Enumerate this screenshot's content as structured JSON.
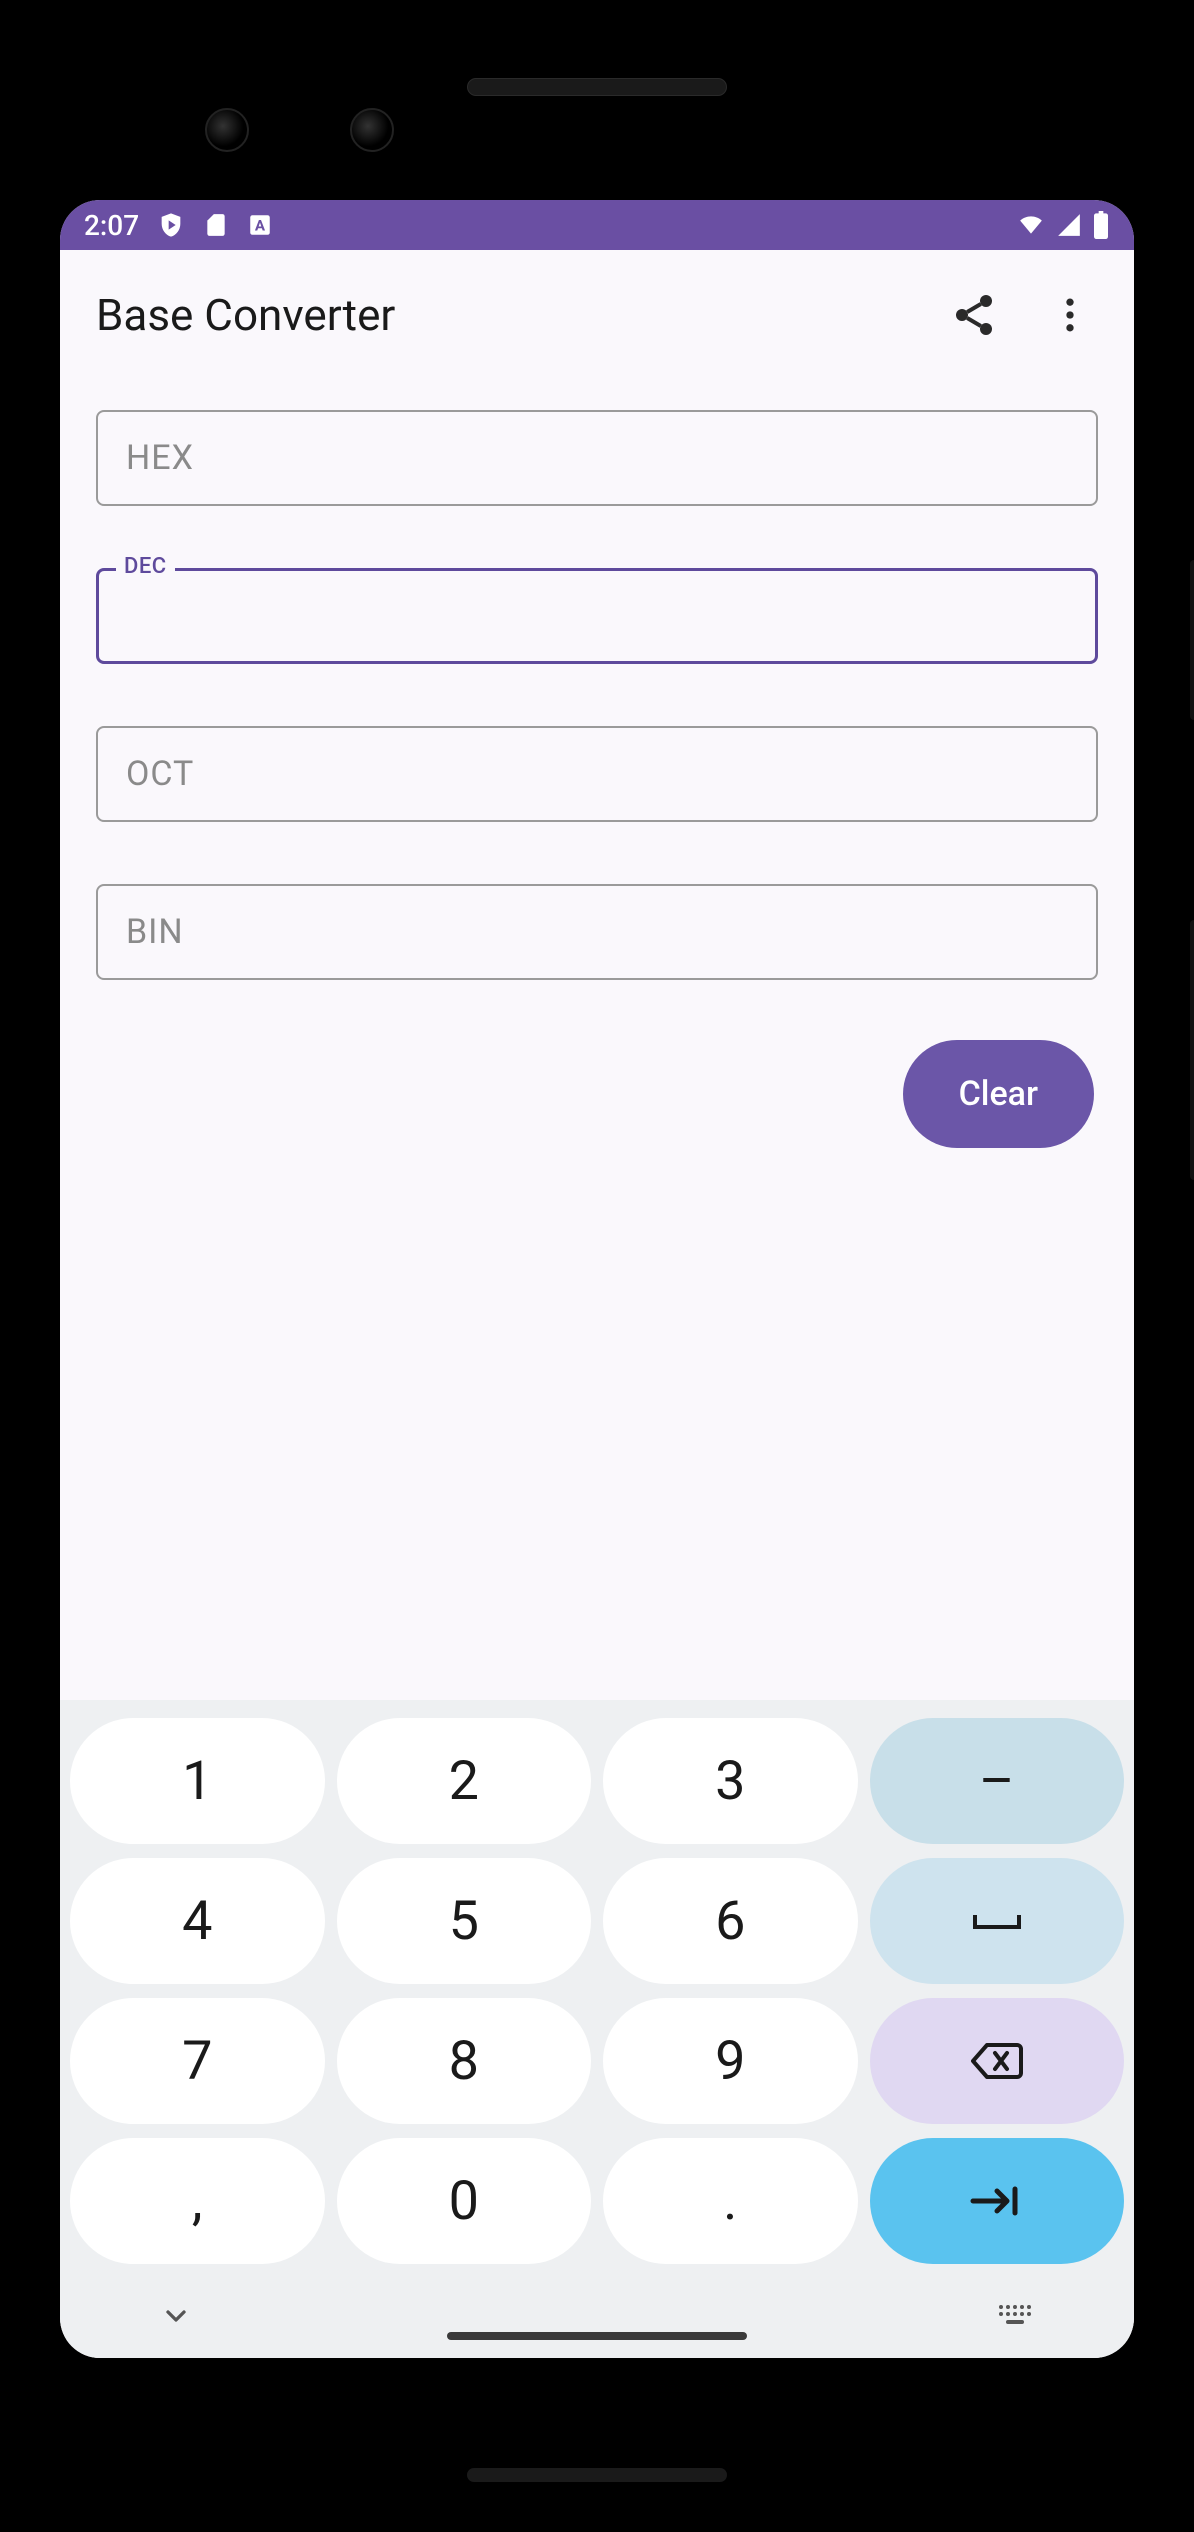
{
  "status_bar": {
    "time": "2:07",
    "icons_left": [
      "shield-play-icon",
      "sd-card-icon",
      "language-a-icon"
    ],
    "icons_right": [
      "wifi-icon",
      "cell-signal-icon",
      "battery-icon"
    ]
  },
  "app_bar": {
    "title": "Base Converter",
    "actions": [
      "share-icon",
      "more-vert-icon"
    ]
  },
  "fields": {
    "hex": {
      "label": "HEX",
      "placeholder": "HEX",
      "value": "",
      "focused": false
    },
    "dec": {
      "label": "DEC",
      "placeholder": "",
      "value": "",
      "focused": true
    },
    "oct": {
      "label": "OCT",
      "placeholder": "OCT",
      "value": "",
      "focused": false
    },
    "bin": {
      "label": "BIN",
      "placeholder": "BIN",
      "value": "",
      "focused": false
    }
  },
  "buttons": {
    "clear": "Clear"
  },
  "keyboard": {
    "rows": [
      [
        {
          "label": "1",
          "type": "num"
        },
        {
          "label": "2",
          "type": "num"
        },
        {
          "label": "3",
          "type": "num"
        },
        {
          "label": "–",
          "type": "op1",
          "name": "dash-key"
        }
      ],
      [
        {
          "label": "4",
          "type": "num"
        },
        {
          "label": "5",
          "type": "num"
        },
        {
          "label": "6",
          "type": "num"
        },
        {
          "label": "␣",
          "type": "op2",
          "name": "space-key",
          "icon": "space-icon"
        }
      ],
      [
        {
          "label": "7",
          "type": "num"
        },
        {
          "label": "8",
          "type": "num"
        },
        {
          "label": "9",
          "type": "num"
        },
        {
          "label": "⌫",
          "type": "op3",
          "name": "backspace-key",
          "icon": "backspace-icon"
        }
      ],
      [
        {
          "label": ",",
          "type": "num"
        },
        {
          "label": "0",
          "type": "num"
        },
        {
          "label": ".",
          "type": "num"
        },
        {
          "label": "→|",
          "type": "op4",
          "name": "tab-next-key",
          "icon": "tab-icon"
        }
      ]
    ],
    "nav": {
      "collapse": "chevron-down-icon",
      "keyboard_toggle": "keyboard-dots-icon"
    }
  },
  "colors": {
    "primary": "#6b56a8",
    "status_bar": "#6a4fa3",
    "focused_border": "#5e4a9c",
    "key_bg": "#ffffff",
    "key_op_blue_light": "#c8dfe9",
    "key_op_lavender": "#e0d8f2",
    "key_op_cyan": "#5ac3ef",
    "screen_bg": "#faf8fc"
  }
}
